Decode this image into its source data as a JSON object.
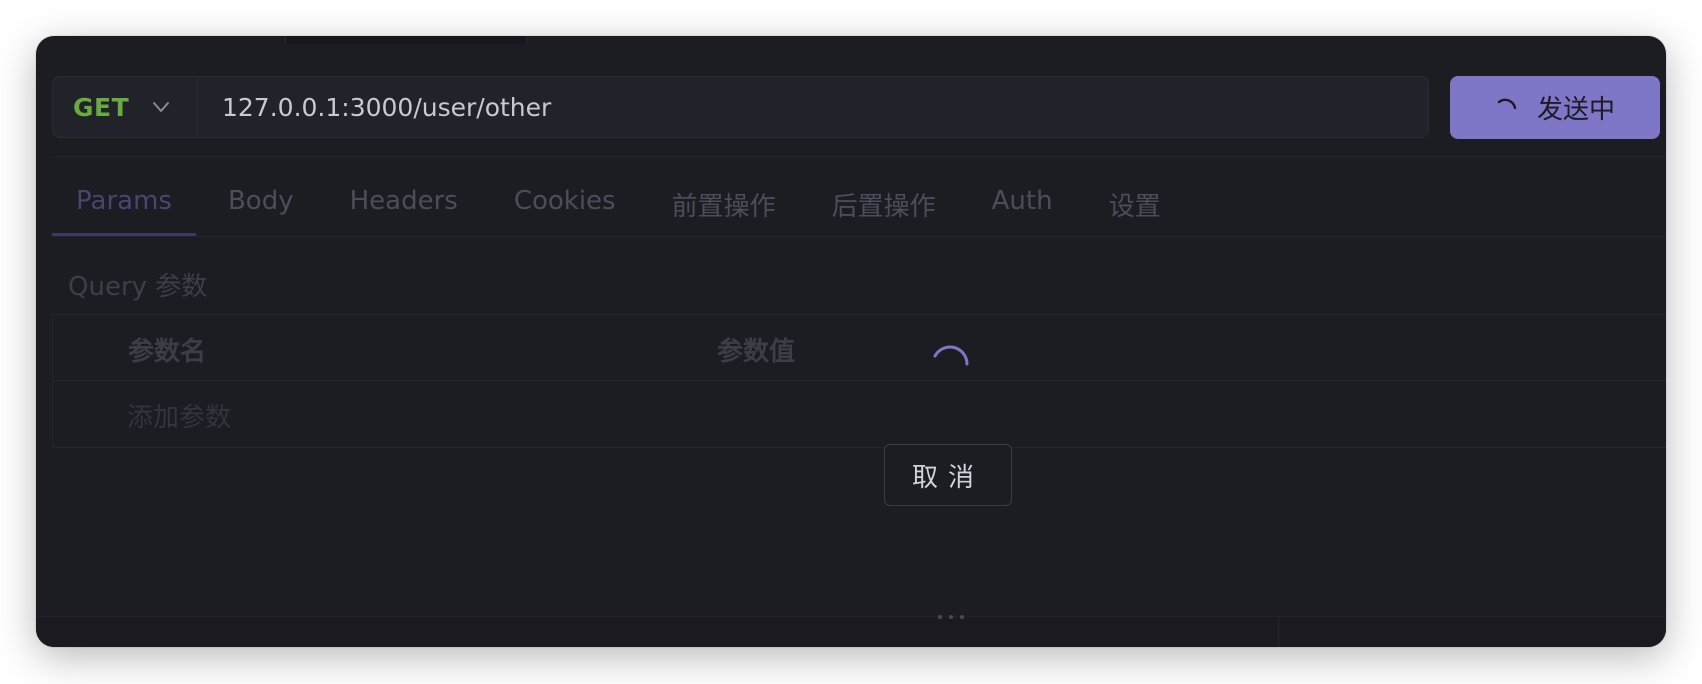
{
  "request": {
    "method": "GET",
    "url": "127.0.0.1:3000/user/other"
  },
  "send_button": {
    "label": "发送中"
  },
  "tabs": [
    {
      "label": "Params",
      "active": true
    },
    {
      "label": "Body"
    },
    {
      "label": "Headers"
    },
    {
      "label": "Cookies"
    },
    {
      "label": "前置操作"
    },
    {
      "label": "后置操作"
    },
    {
      "label": "Auth"
    },
    {
      "label": "设置"
    }
  ],
  "query_section": {
    "title": "Query 参数",
    "columns": [
      "参数名",
      "参数值"
    ],
    "add_label": "添加参数"
  },
  "overlay": {
    "cancel_label": "取消"
  },
  "colors": {
    "accent": "#7e76c6",
    "method_get": "#6aab3f",
    "background": "#1c1c23"
  },
  "icons": {
    "method_dropdown": "chevron-down-icon",
    "send_loading": "loading-spinner-icon",
    "overlay_loading": "loading-spinner-icon",
    "splitter": "more-horizontal-icon"
  }
}
